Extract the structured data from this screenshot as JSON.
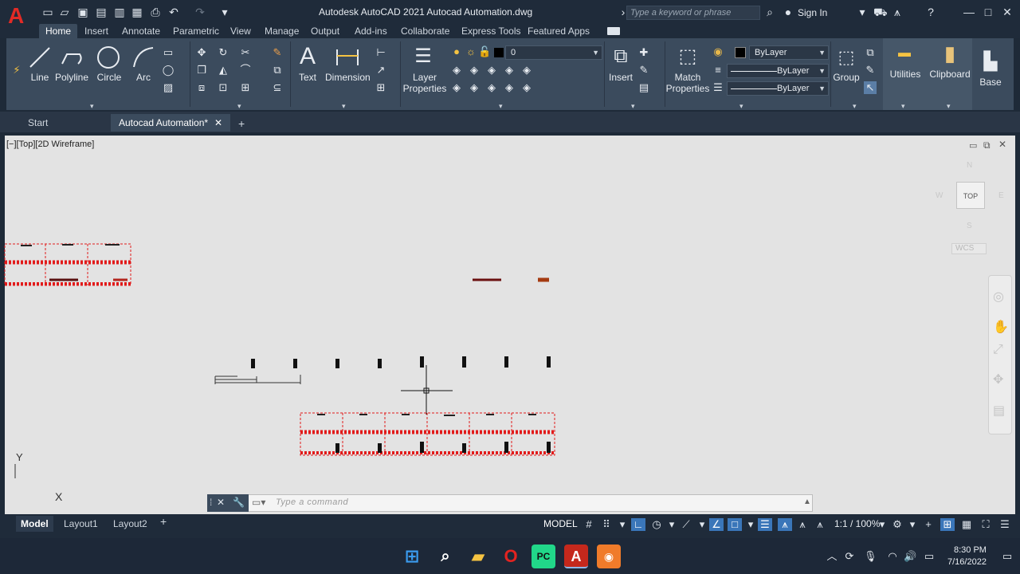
{
  "app": {
    "logo_letter": "A",
    "title": "Autodesk AutoCAD 2021    Autocad Automation.dwg",
    "search_placeholder": "Type a keyword or phrase",
    "sign_in": "Sign In"
  },
  "menu_tabs": [
    "Home",
    "Insert",
    "Annotate",
    "Parametric",
    "View",
    "Manage",
    "Output",
    "Add-ins",
    "Collaborate",
    "Express Tools",
    "Featured Apps"
  ],
  "ribbon": {
    "draw": {
      "line": "Line",
      "polyline": "Polyline",
      "circle": "Circle",
      "arc": "Arc"
    },
    "annotation": {
      "text": "Text",
      "dimension": "Dimension"
    },
    "layers": {
      "layer_properties_1": "Layer",
      "layer_properties_2": "Properties",
      "current_layer": "0"
    },
    "block": {
      "insert": "Insert"
    },
    "properties": {
      "match_1": "Match",
      "match_2": "Properties",
      "color": "ByLayer",
      "linetype": "ByLayer",
      "lineweight": "ByLayer"
    },
    "groups": {
      "group": "Group"
    },
    "utilities": {
      "label": "Utilities"
    },
    "clipboard": {
      "label": "Clipboard"
    },
    "view": {
      "base": "Base"
    }
  },
  "file_tabs": {
    "start": "Start",
    "active": "Autocad Automation*"
  },
  "viewport": {
    "label": "[−][Top][2D Wireframe]",
    "viewcube": {
      "top": "TOP",
      "north": "N",
      "south": "S",
      "east": "E",
      "west": "W",
      "wcs": "WCS"
    },
    "ucs": {
      "x": "X",
      "y": "Y"
    }
  },
  "command_line": {
    "placeholder": "Type  a  command"
  },
  "layout_tabs": [
    "Model",
    "Layout1",
    "Layout2"
  ],
  "status": {
    "model": "MODEL",
    "scale": "1:1 / 100%"
  },
  "taskbar": {
    "time": "8:30 PM",
    "date": "7/16/2022"
  },
  "colors": {
    "accent_red": "#e22b26",
    "drawing_red": "#e21b1b",
    "ribbon_bg": "#3b4b5d",
    "canvas_bg": "#e3e3e3"
  }
}
